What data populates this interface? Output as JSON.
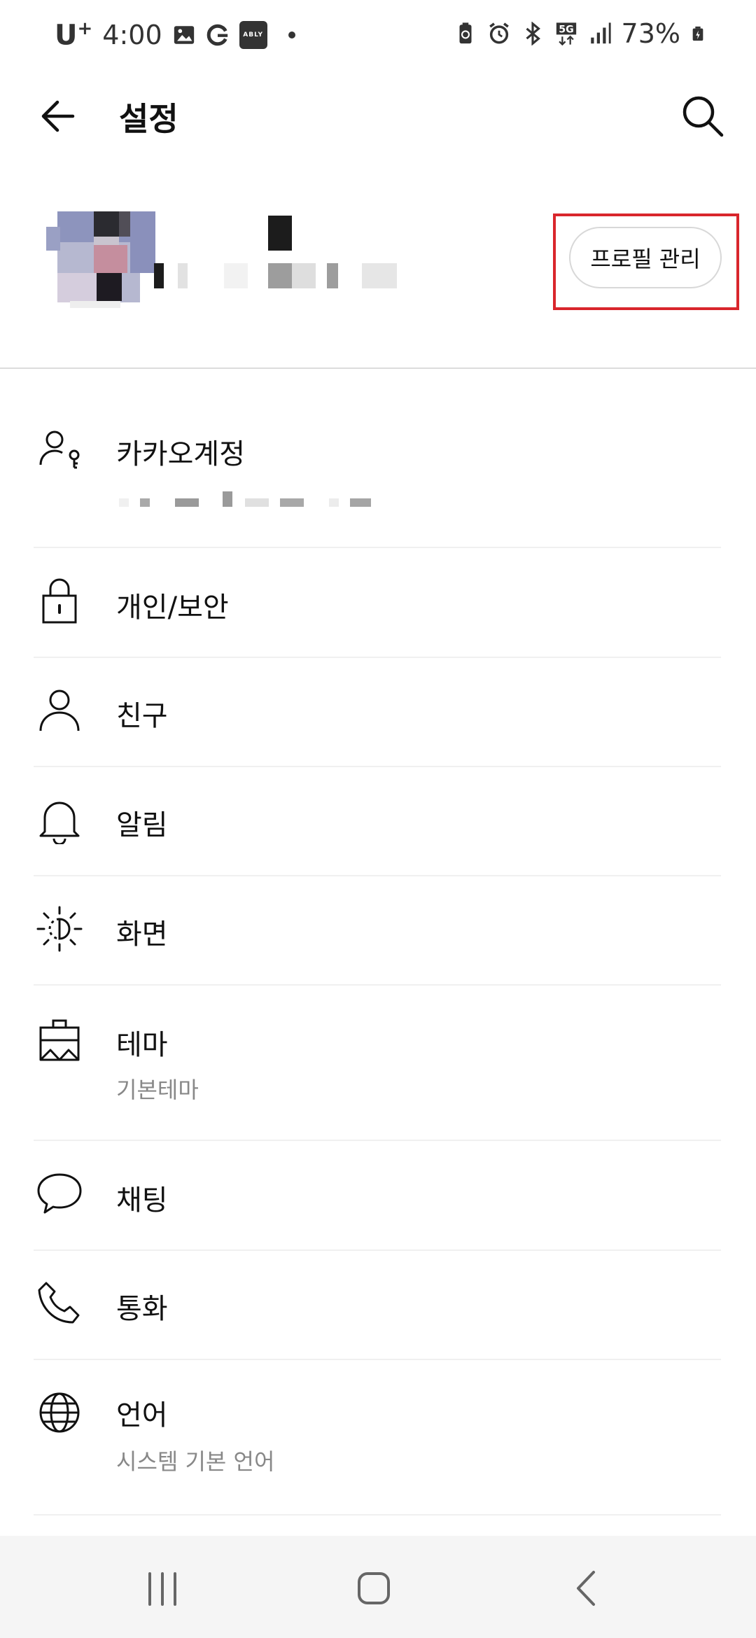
{
  "status_bar": {
    "carrier": "U",
    "carrier_sup": "+",
    "time": "4:00",
    "app_badge": "ABLY",
    "battery": "73%"
  },
  "header": {
    "title": "설정"
  },
  "profile": {
    "manage_button": "프로필 관리"
  },
  "menu": [
    {
      "label": "카카오계정",
      "sub": ""
    },
    {
      "label": "개인/보안",
      "sub": ""
    },
    {
      "label": "친구",
      "sub": ""
    },
    {
      "label": "알림",
      "sub": ""
    },
    {
      "label": "화면",
      "sub": ""
    },
    {
      "label": "테마",
      "sub": "기본테마"
    },
    {
      "label": "채팅",
      "sub": ""
    },
    {
      "label": "통화",
      "sub": ""
    },
    {
      "label": "언어",
      "sub": "시스템 기본 언어"
    }
  ],
  "icons": {
    "back": "arrow-left-icon",
    "search": "search-icon",
    "account": "account-key-icon",
    "privacy": "lock-icon",
    "friends": "person-icon",
    "notifications": "bell-icon",
    "display": "sun-icon",
    "theme": "paint-brush-icon",
    "chat": "speech-bubble-icon",
    "call": "phone-icon",
    "language": "globe-icon"
  },
  "colors": {
    "highlight": "#d9262c",
    "sub_text": "#888888",
    "nav_bg": "#f5f5f5"
  }
}
